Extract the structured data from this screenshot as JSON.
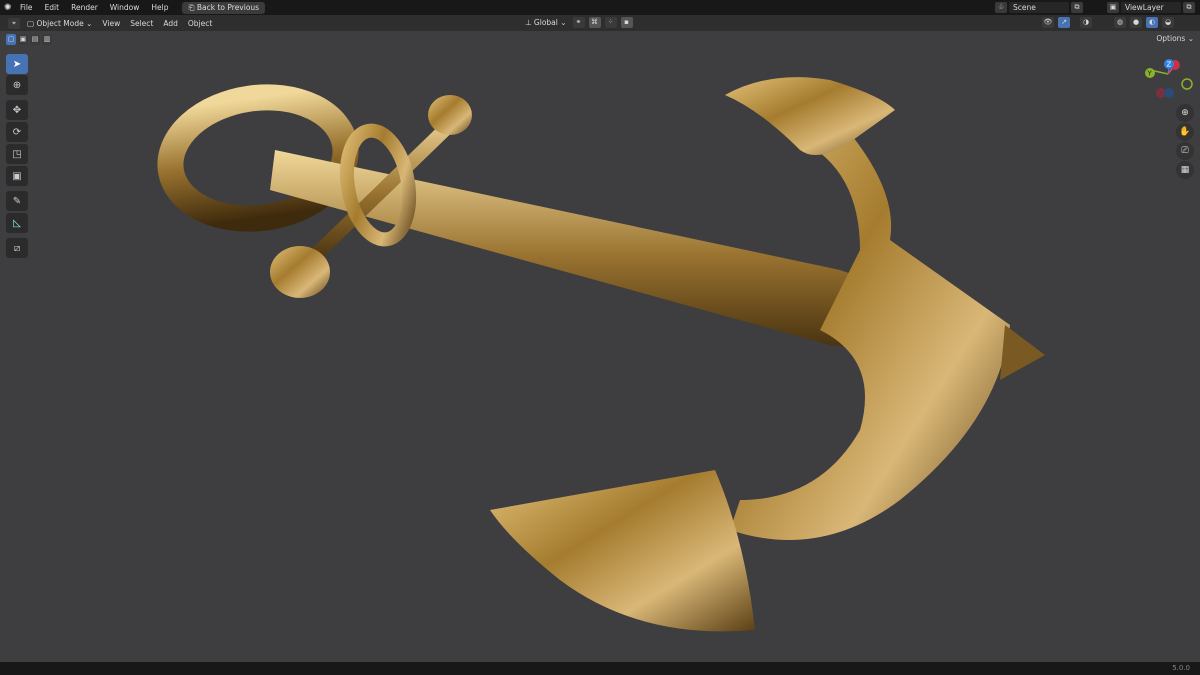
{
  "topbar": {
    "menu": [
      "File",
      "Edit",
      "Render",
      "Window",
      "Help"
    ],
    "back_button": "Back to Previous",
    "scene": "Scene",
    "view_layer": "ViewLayer"
  },
  "header": {
    "mode": "Object Mode",
    "menu": [
      "View",
      "Select",
      "Add",
      "Object"
    ],
    "orientation": "Global",
    "options": "Options"
  },
  "tools": [
    "select-box",
    "cursor",
    "move",
    "rotate",
    "scale",
    "transform",
    "annotate",
    "measure",
    "add-cube"
  ],
  "gizmo": {
    "z": "Z",
    "x": "X",
    "y": "Y"
  },
  "status": {
    "version": "5.0.0"
  },
  "colors": {
    "accent": "#4772b3",
    "viewport": "#3e3d3f",
    "gold": "#b8913a"
  }
}
